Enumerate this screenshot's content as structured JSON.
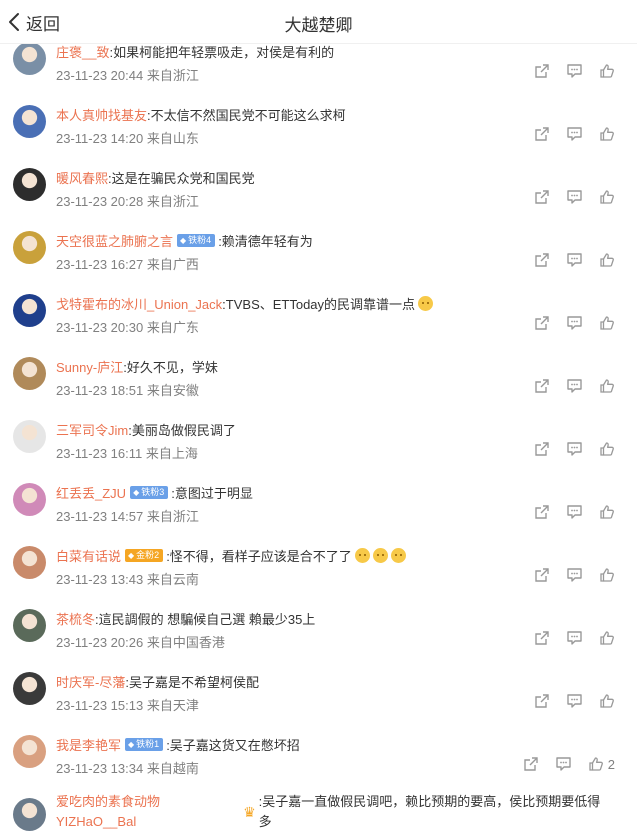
{
  "header": {
    "back_label": "返回",
    "title": "大越楚卿"
  },
  "colors": {
    "username": "#eb7350",
    "meta": "#808080",
    "badge_blue": "#6aa0e8",
    "badge_orange": "#f5a623"
  },
  "comments": [
    {
      "user": "庄褒__致",
      "text": ":如果柯能把年轻票吸走，对侯是有利的",
      "meta": "23-11-23 20:44 来自浙江",
      "avatar_color": "#7a8fa6"
    },
    {
      "user": "本人真帅找基友",
      "text": ":不太信不然国民党不可能这么求柯",
      "meta": "23-11-23 14:20 来自山东",
      "avatar_color": "#4a6fb5"
    },
    {
      "user": "暖风春熙",
      "text": ":这是在骗民众党和国民党",
      "meta": "23-11-23 20:28 来自浙江",
      "avatar_color": "#2d2d2d"
    },
    {
      "user": "天空很蓝之肺腑之言",
      "badge": "铁粉4",
      "badge_color": "#6aa0e8",
      "text": ":赖清德年轻有为",
      "meta": "23-11-23 16:27 来自广西",
      "avatar_color": "#c9a13b"
    },
    {
      "user": "戈特霍布的冰川_Union_Jack",
      "text": ":TVBS、ETToday的民调靠谱一点",
      "emojis": 1,
      "meta": "23-11-23 20:30 来自广东",
      "avatar_color": "#1f3f8c"
    },
    {
      "user": "Sunny-庐江",
      "text": ":好久不见，学妹",
      "meta": "23-11-23 18:51 来自安徽",
      "avatar_color": "#b08a5a"
    },
    {
      "user": "三军司令Jim",
      "text": ":美丽岛做假民调了",
      "meta": "23-11-23 16:11 来自上海",
      "avatar_color": "#e6e6e6"
    },
    {
      "user": "红丢丢_ZJU",
      "badge": "铁粉3",
      "badge_color": "#6aa0e8",
      "text": ":意图过于明显",
      "meta": "23-11-23 14:57 来自浙江",
      "avatar_color": "#d08ab8"
    },
    {
      "user": "白菜有话说",
      "badge": "金粉2",
      "badge_color": "#f5a623",
      "text": ":怪不得，看样子应该是合不了了",
      "emojis": 3,
      "meta": "23-11-23 13:43 来自云南",
      "avatar_color": "#c98a6a"
    },
    {
      "user": "茶梳冬",
      "text": ":這民調假的 想騙候自己選 賴最少35上",
      "meta": "23-11-23 20:26 来自中国香港",
      "avatar_color": "#5a6a5a"
    },
    {
      "user": "时庆军-尽藩",
      "text": ":吴子嘉是不希望柯侯配",
      "meta": "23-11-23 15:13 来自天津",
      "avatar_color": "#3a3a3a"
    },
    {
      "user": "我是李艳军",
      "badge": "铁粉1",
      "badge_color": "#6aa0e8",
      "text": ":吴子嘉这货又在憋坏招",
      "meta": "23-11-23 13:34 来自越南",
      "avatar_color": "#d9a080",
      "like_count": "2"
    },
    {
      "user": "爱吃肉的素食动物YIZHaO__Bal",
      "crown": true,
      "text": ":吴子嘉一直做假民调吧，赖比预期的要高，侯比预期要低得多",
      "meta": "",
      "avatar_color": "#6a7a8a"
    }
  ]
}
